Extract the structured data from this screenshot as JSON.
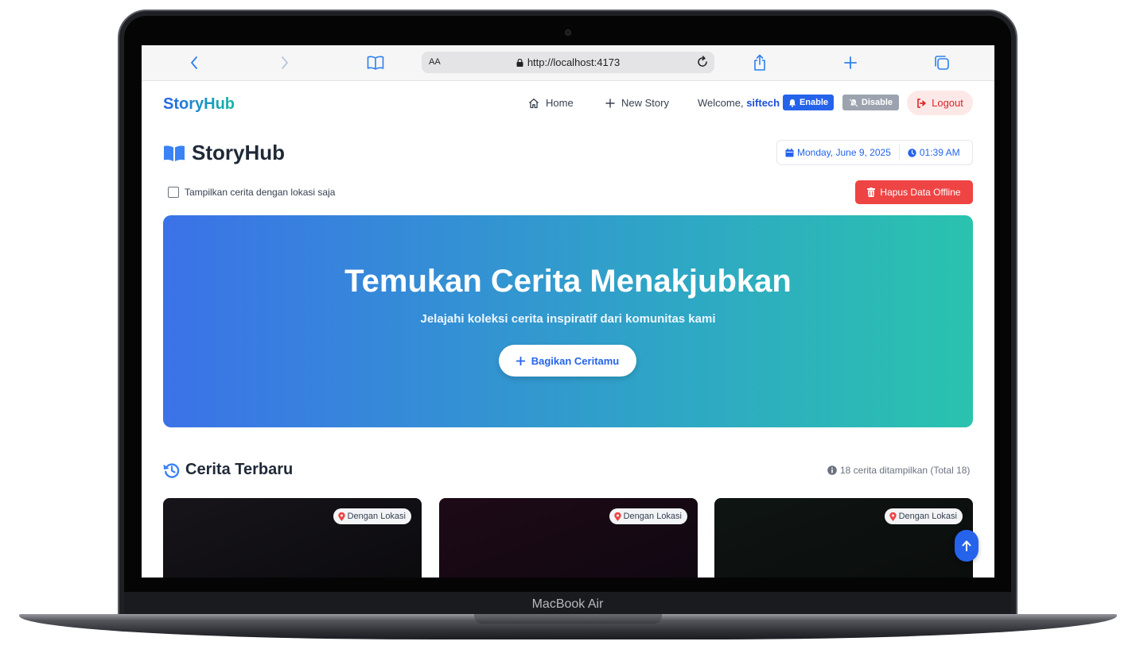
{
  "device": {
    "label": "MacBook Air"
  },
  "browser": {
    "text_size_label": "AA",
    "url": "http://localhost:4173"
  },
  "nav": {
    "brand": "StoryHub",
    "home": "Home",
    "new_story": "New Story",
    "welcome_prefix": "Welcome,",
    "username": "siftech",
    "enable": "Enable",
    "disable": "Disable",
    "logout": "Logout"
  },
  "header": {
    "title": "StoryHub",
    "date": "Monday, June 9, 2025",
    "time": "01:39 AM"
  },
  "filter": {
    "label": "Tampilkan cerita dengan lokasi saja",
    "checked": false
  },
  "clear_offline": "Hapus Data Offline",
  "hero": {
    "title": "Temukan Cerita Menakjubkan",
    "subtitle": "Jelajahi koleksi cerita inspiratif dari komunitas kami",
    "cta": "Bagikan Ceritamu"
  },
  "stories": {
    "title": "Cerita Terbaru",
    "count_text": "18 cerita ditampilkan (Total 18)",
    "cards": [
      {
        "badge": "Dengan Lokasi"
      },
      {
        "badge": "Dengan Lokasi"
      },
      {
        "badge": "Dengan Lokasi"
      }
    ]
  },
  "colors": {
    "primary": "#2563eb",
    "danger": "#ef4444",
    "hero_start": "#3b72e8",
    "hero_end": "#2ac3ae",
    "disabled": "#9ca3af"
  }
}
